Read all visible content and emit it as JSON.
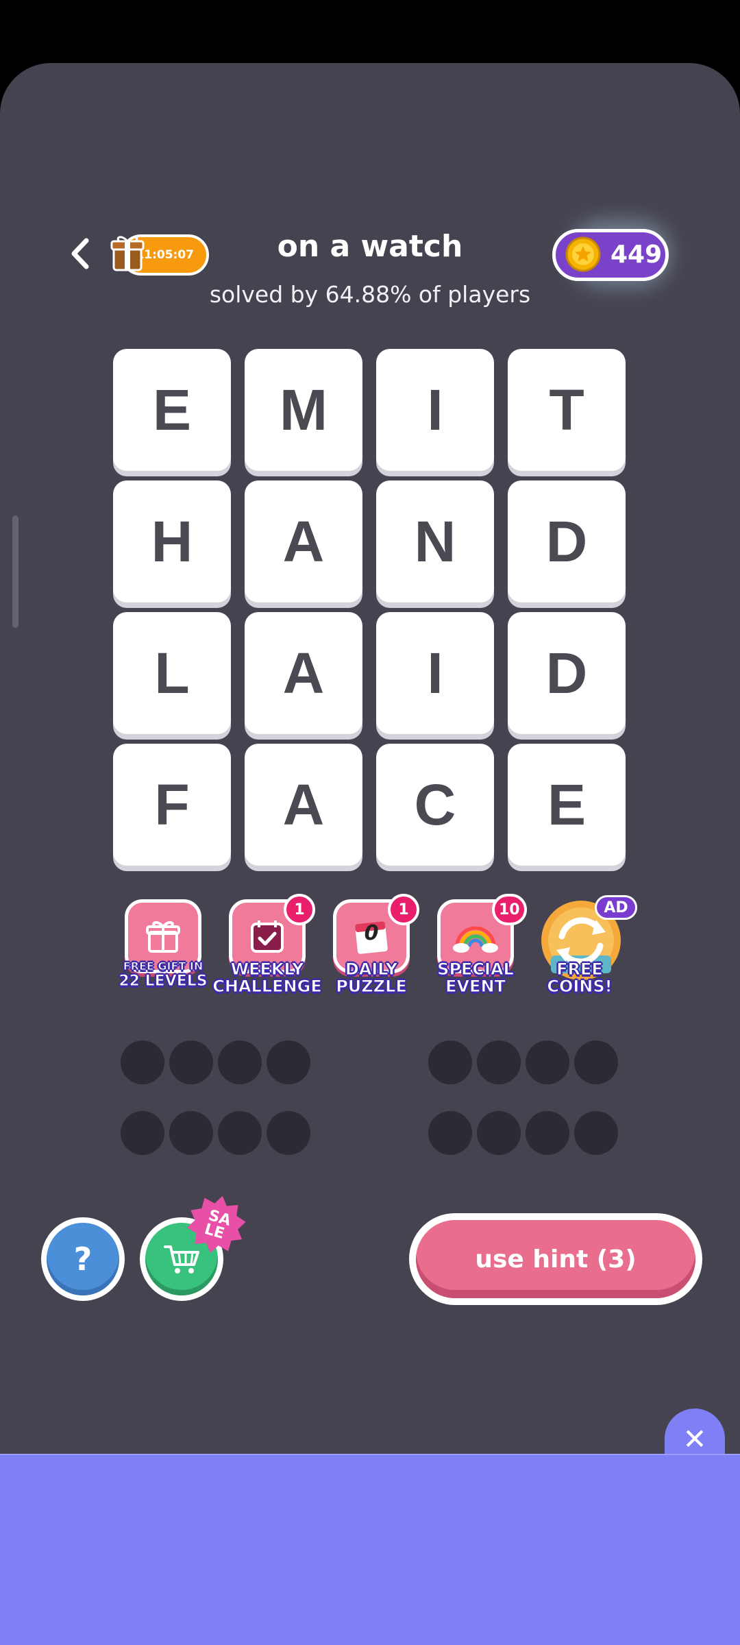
{
  "header": {
    "timer": "11:05:07",
    "title": "on a watch",
    "subtitle": "solved by 64.88% of players",
    "coins": "449"
  },
  "grid": {
    "letters": [
      [
        "E",
        "M",
        "I",
        "T"
      ],
      [
        "H",
        "A",
        "N",
        "D"
      ],
      [
        "L",
        "A",
        "I",
        "D"
      ],
      [
        "F",
        "A",
        "C",
        "E"
      ]
    ]
  },
  "bonuses": {
    "free_gift": {
      "line1": "FREE GIFT IN",
      "line2": "22 LEVELS"
    },
    "weekly": {
      "line1": "WEEKLY",
      "line2": "CHALLENGE",
      "badge": "1"
    },
    "daily": {
      "line1": "DAILY",
      "line2": "PUZZLE",
      "badge": "1",
      "calendar_value": "0"
    },
    "special": {
      "line1": "SPECIAL",
      "line2": "EVENT",
      "badge": "10"
    },
    "free_coins": {
      "line1": "FREE",
      "line2": "COINS!",
      "badge": "AD"
    }
  },
  "answer_slots": {
    "rows": 2,
    "groups": 2,
    "per_group": 4
  },
  "actions": {
    "help_label": "?",
    "sale_label_1": "SA",
    "sale_label_2": "LE",
    "hint_label": "use hint (3)",
    "close_label": "✕"
  },
  "colors": {
    "background": "#45434f",
    "tile": "#ffffff",
    "tile_text": "#4b4a52",
    "hint": "#e96e8e",
    "coins": "#7a42c8",
    "timer": "#f79a0e",
    "ad_banner": "#7f80f6"
  },
  "icons": [
    "back-icon",
    "gift-icon",
    "coin-icon",
    "calendar-icon",
    "rainbow-icon",
    "refresh-icon",
    "cart-icon"
  ]
}
